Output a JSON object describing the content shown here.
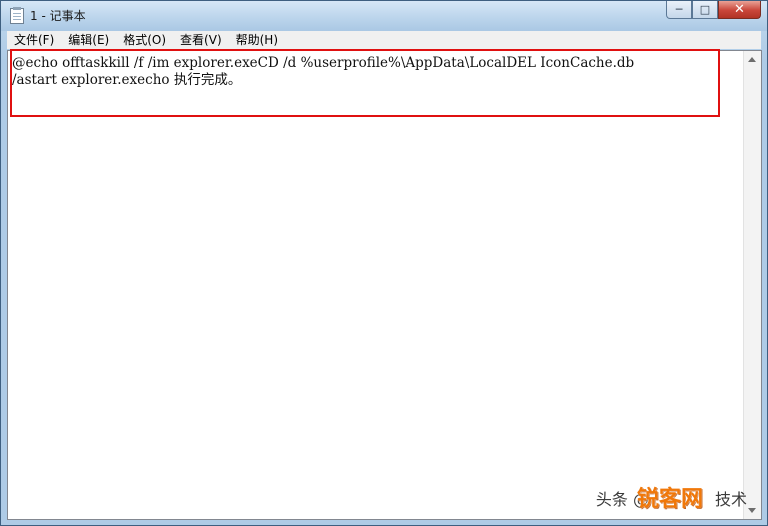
{
  "window": {
    "title": "1 - 记事本"
  },
  "title_buttons": {
    "minimize": "─",
    "maximize": "□",
    "close": "✕"
  },
  "menu": [
    "文件(F)",
    "编辑(E)",
    "格式(O)",
    "查看(V)",
    "帮助(H)"
  ],
  "editor": {
    "lines": [
      "@echo offtaskkill /f /im explorer.exeCD /d %userprofile%\\AppData\\LocalDEL IconCache.db",
      "/astart explorer.execho 执行完成。"
    ]
  },
  "watermark": {
    "text": "头条 @",
    "logo": "锐客网",
    "tail": "技术"
  }
}
